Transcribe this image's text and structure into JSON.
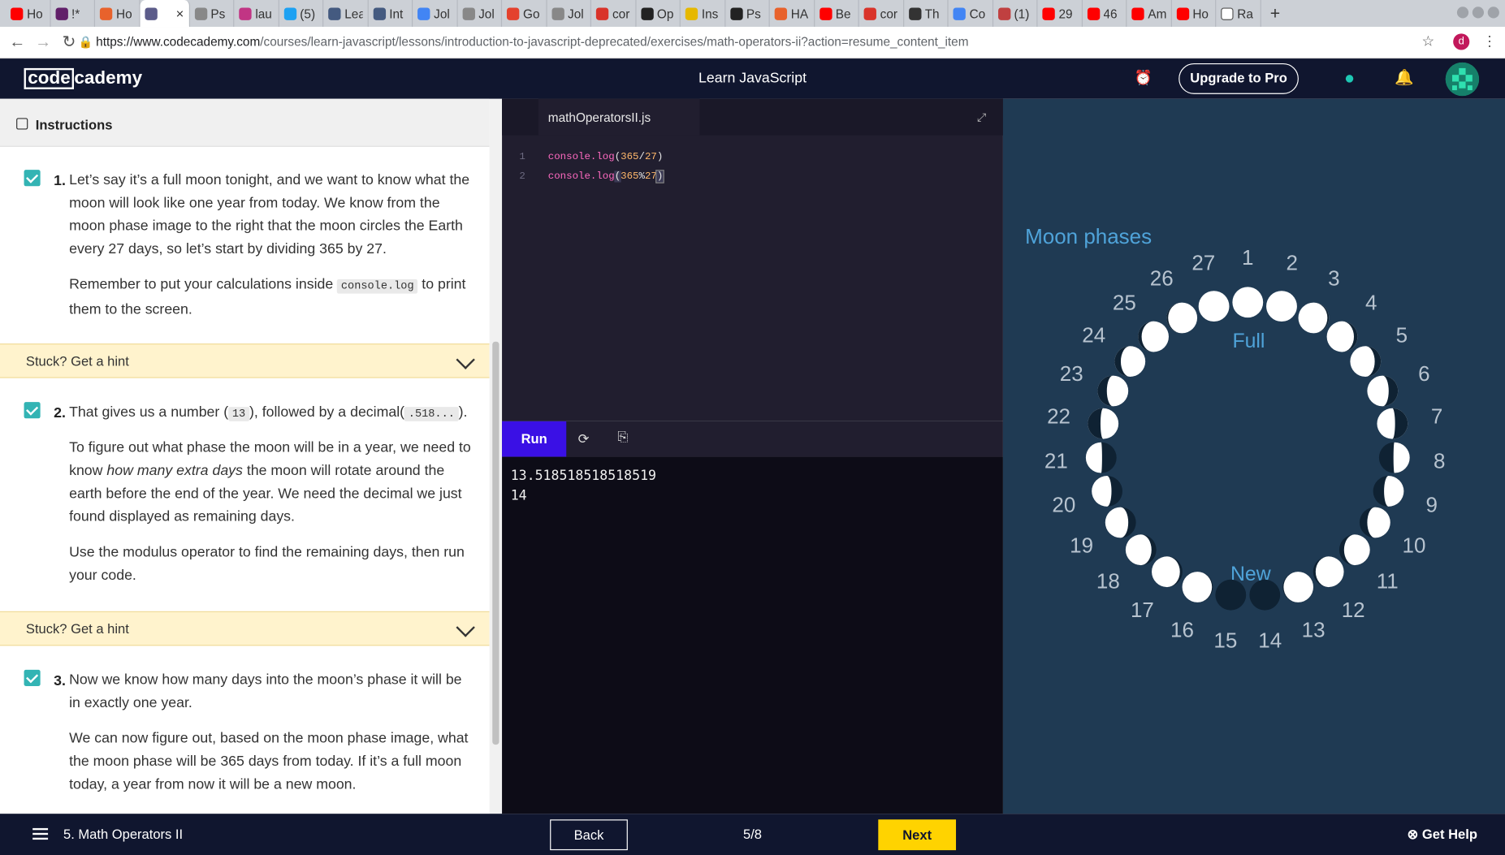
{
  "browser": {
    "tabs": [
      {
        "label": "Ho",
        "icon": "youtube-icon",
        "color": "#ff0000"
      },
      {
        "label": "!*",
        "icon": "slack-icon",
        "color": "#611f69"
      },
      {
        "label": "Ho",
        "icon": "codecademy-icon",
        "color": "#e8622c"
      },
      {
        "label": "",
        "icon": "codecademy-doc-icon",
        "color": "#5c5c8a"
      },
      {
        "label": "Ps",
        "icon": "page-icon",
        "color": "#888888"
      },
      {
        "label": "lau",
        "icon": "instagram-icon",
        "color": "#c13584"
      },
      {
        "label": "(5)",
        "icon": "twitter-icon",
        "color": "#1da1f2"
      },
      {
        "label": "Lea",
        "icon": "page-icon",
        "color": "#445a80"
      },
      {
        "label": "Int",
        "icon": "page-icon",
        "color": "#445a80"
      },
      {
        "label": "Jol",
        "icon": "google-icon",
        "color": "#4285f4"
      },
      {
        "label": "Jol",
        "icon": "page-icon",
        "color": "#888888"
      },
      {
        "label": "Go",
        "icon": "flipboard-icon",
        "color": "#e4412d"
      },
      {
        "label": "Jol",
        "icon": "page-icon",
        "color": "#888888"
      },
      {
        "label": "cor",
        "icon": "ask-icon",
        "color": "#d9332a"
      },
      {
        "label": "Op",
        "icon": "github-icon",
        "color": "#222222"
      },
      {
        "label": "Ins",
        "icon": "bookmark-icon",
        "color": "#e6b800"
      },
      {
        "label": "Ps",
        "icon": "github-icon",
        "color": "#222222"
      },
      {
        "label": "HA",
        "icon": "codecademy-icon",
        "color": "#e8622c"
      },
      {
        "label": "Be",
        "icon": "youtube-icon",
        "color": "#ff0000"
      },
      {
        "label": "cor",
        "icon": "ask-icon",
        "color": "#d9332a"
      },
      {
        "label": "Th",
        "icon": "medium-icon",
        "color": "#333333"
      },
      {
        "label": "Co",
        "icon": "google-icon",
        "color": "#4285f4"
      },
      {
        "label": "(1)",
        "icon": "page-icon",
        "color": "#c04040"
      },
      {
        "label": "29",
        "icon": "youtube-icon",
        "color": "#ff0000"
      },
      {
        "label": "46",
        "icon": "youtube-icon",
        "color": "#ff0000"
      },
      {
        "label": "Am",
        "icon": "youtube-icon",
        "color": "#ff0000"
      },
      {
        "label": "Ho",
        "icon": "youtube-icon",
        "color": "#ff0000"
      },
      {
        "label": "Ra",
        "icon": "wikipedia-icon",
        "color": "#ffffff"
      }
    ],
    "active_tab": 3,
    "url_domain": "https://www.codecademy.com",
    "url_path": "/courses/learn-javascript/lessons/introduction-to-javascript-deprecated/exercises/math-operators-ii?action=resume_content_item",
    "profile_initial": "d"
  },
  "header": {
    "logo_box": "code",
    "logo_rest": "cademy",
    "course_title": "Learn JavaScript",
    "upgrade_label": "Upgrade to Pro"
  },
  "instructions": {
    "title": "Instructions",
    "steps": [
      {
        "num": "1.",
        "p1": "Let’s say it’s a full moon tonight, and we want to know what the moon will look like one year from today. We know from the moon phase image to the right that the moon circles the Earth every 27 days, so let’s start by dividing 365 by 27.",
        "p2a": "Remember to put your calculations inside",
        "p2code": "console.log",
        "p2b": "to print them to the screen."
      },
      {
        "num": "2.",
        "p1a": "That gives us a number (",
        "p1code1": "13",
        "p1b": "), followed by a decimal(",
        "p1code2": ".518...",
        "p1c": ").",
        "p2a": "To figure out what phase the moon will be in a year, we need to know",
        "p2em": "how many extra days",
        "p2b": "the moon will rotate around the earth before the end of the year. We need the decimal we just found displayed as remaining days.",
        "p3": "Use the modulus operator to find the remaining days, then run your code."
      },
      {
        "num": "3.",
        "p1": "Now we know how many days into the moon’s phase it will be in exactly one year.",
        "p2": "We can now figure out, based on the moon phase image, what the moon phase will be 365 days from today. If it’s a full moon today, a year from now it will be a new moon."
      }
    ],
    "hint_label": "Stuck? Get a hint"
  },
  "editor": {
    "filename": "mathOperatorsII.js",
    "lines": [
      {
        "n": "1",
        "fn": "console.log",
        "arg1": "365",
        "op": "/",
        "arg2": "27"
      },
      {
        "n": "2",
        "fn": "console.log",
        "arg1": "365",
        "op": "%",
        "arg2": "27"
      }
    ],
    "run_label": "Run"
  },
  "output": {
    "lines": [
      "13.518518518518519",
      "14"
    ]
  },
  "moon_diagram": {
    "title": "Moon phases",
    "full_label": "Full",
    "new_label": "New",
    "days": [
      "1",
      "2",
      "3",
      "4",
      "5",
      "6",
      "7",
      "8",
      "9",
      "10",
      "11",
      "12",
      "13",
      "14",
      "15",
      "16",
      "17",
      "18",
      "19",
      "20",
      "21",
      "22",
      "23",
      "24",
      "25",
      "26",
      "27"
    ],
    "bg_color": "#1f3a53",
    "accent_color": "#4fa3d9"
  },
  "footer": {
    "lesson": "5. Math Operators II",
    "back_label": "Back",
    "progress": "5/8",
    "next_label": "Next",
    "help_label": "Get Help"
  }
}
